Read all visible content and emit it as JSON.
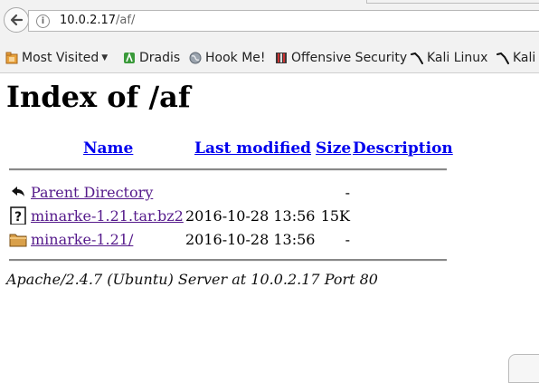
{
  "browser": {
    "url_host": "10.0.2.17",
    "url_path": "/af/",
    "info_symbol": "i"
  },
  "bookmarks": [
    {
      "label": "Most Visited",
      "icon": "most-visited-icon",
      "has_caret": true
    },
    {
      "label": "Dradis",
      "icon": "dradis-icon"
    },
    {
      "label": "Hook Me!",
      "icon": "globe-icon"
    },
    {
      "label": "Offensive Security",
      "icon": "offsec-icon"
    },
    {
      "label": "Kali Linux",
      "icon": "kali-dragon-icon"
    },
    {
      "label": "Kali",
      "icon": "kali-dragon-icon"
    }
  ],
  "page": {
    "title": "Index of /af",
    "headers": {
      "name": "Name",
      "modified": "Last modified",
      "size": "Size",
      "description": "Description"
    },
    "rows": [
      {
        "name": "Parent Directory",
        "modified": "",
        "size": "-",
        "icon": "back-arrow-icon"
      },
      {
        "name": "minarke-1.21.tar.bz2",
        "modified": "2016-10-28 13:56",
        "size": "15K",
        "icon": "unknown-file-icon"
      },
      {
        "name": "minarke-1.21/",
        "modified": "2016-10-28 13:56",
        "size": "-",
        "icon": "folder-icon"
      }
    ],
    "address": "Apache/2.4.7 (Ubuntu) Server at 10.0.2.17 Port 80"
  },
  "colors": {
    "link_unvisited": "#0000ee",
    "link_visited": "#551a8b",
    "toolbar_bg": "#f2f2f2"
  }
}
